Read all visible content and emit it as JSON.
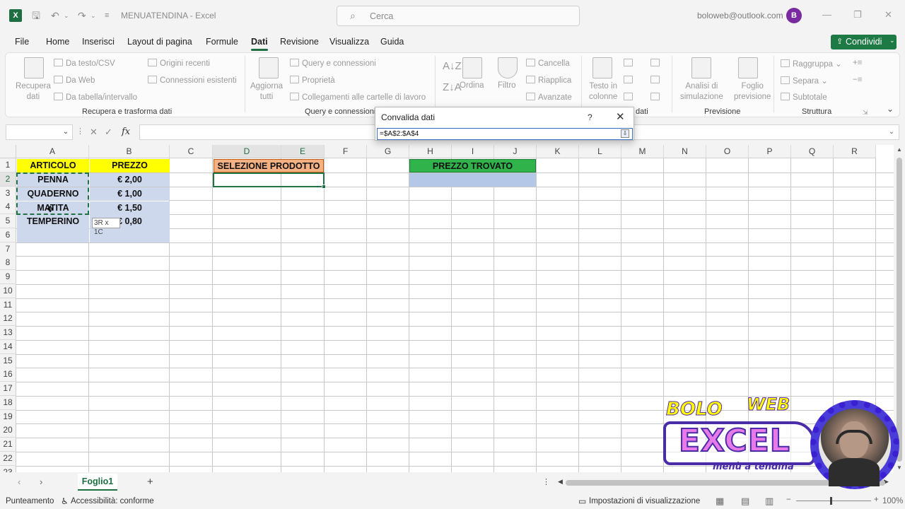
{
  "window": {
    "doc_title": "MENUATENDINA  -  Excel",
    "search_placeholder": "Cerca",
    "account": "boloweb@outlook.com",
    "avatar_initial": "B"
  },
  "menu": {
    "tabs": [
      "File",
      "Home",
      "Inserisci",
      "Layout di pagina",
      "Formule",
      "Dati",
      "Revisione",
      "Visualizza",
      "Guida"
    ],
    "active": "Dati",
    "share_label": "Condividi"
  },
  "ribbon": {
    "recupera": {
      "big": "Recupera\ndati",
      "items": [
        "Da testo/CSV",
        "Da Web",
        "Da tabella/intervallo",
        "Origini recenti",
        "Connessioni esistenti"
      ],
      "group": "Recupera e trasforma dati"
    },
    "query": {
      "big": "Aggiorna\ntutti",
      "items": [
        "Query e connessioni",
        "Proprietà",
        "Collegamenti alle cartelle di lavoro"
      ],
      "group": "Query e connessioni"
    },
    "ordina": {
      "sort": "Ordina",
      "filter": "Filtro",
      "items": [
        "Cancella",
        "Riapplica",
        "Avanzate"
      ]
    },
    "strumenti": {
      "big": "Testo in\ncolonne",
      "group_tail": "dati"
    },
    "previsione": {
      "analisi": "Analisi di\nsimulazione",
      "foglio": "Foglio\nprevisione",
      "group": "Previsione"
    },
    "struttura": {
      "items": [
        "Raggruppa",
        "Separa",
        "Subtotale"
      ],
      "group": "Struttura"
    }
  },
  "formula_bar": {
    "name_box": "",
    "fx": "fx",
    "formula": ""
  },
  "sheet": {
    "columns": [
      "A",
      "B",
      "C",
      "D",
      "E",
      "F",
      "G",
      "H",
      "I",
      "J",
      "K",
      "L",
      "M",
      "N",
      "O",
      "P",
      "Q",
      "R"
    ],
    "rows": [
      "1",
      "2",
      "3",
      "4",
      "5",
      "6",
      "7",
      "8",
      "9",
      "10",
      "11",
      "12",
      "13",
      "14",
      "15",
      "16",
      "17",
      "18",
      "19",
      "20",
      "21",
      "22",
      "23"
    ],
    "header_articolo": "ARTICOLO",
    "header_prezzo": "PREZZO",
    "header_selezione": "SELEZIONE PRODOTTO",
    "header_trovato": "PREZZO TROVATO",
    "articoli": [
      "PENNA",
      "QUADERNO",
      "MATITA",
      "TEMPERINO"
    ],
    "prezzi": [
      "€ 2,00",
      "€ 1,00",
      "€ 1,50",
      "€ 0,80"
    ],
    "tooltip": "3R x 1C"
  },
  "dialog": {
    "title": "Convalida dati",
    "help": "?",
    "close": "✕",
    "value": "=$A$2:$A$4"
  },
  "sheet_tabs": {
    "active": "Foglio1"
  },
  "status": {
    "mode": "Punteamento",
    "accessibility": "Accessibilità: conforme",
    "view_settings": "Impostazioni di visualizzazione",
    "zoom": "100%"
  },
  "overlay": {
    "bolo": "BOLO",
    "web": "WEB",
    "excel": "EXCEL",
    "subtitle": "menù a tendina"
  },
  "colors": {
    "accent": "#1d6f42",
    "yellow": "#ffff00",
    "orange": "#f4b183",
    "green": "#2fb34a",
    "blue": "#cdd8ec"
  }
}
